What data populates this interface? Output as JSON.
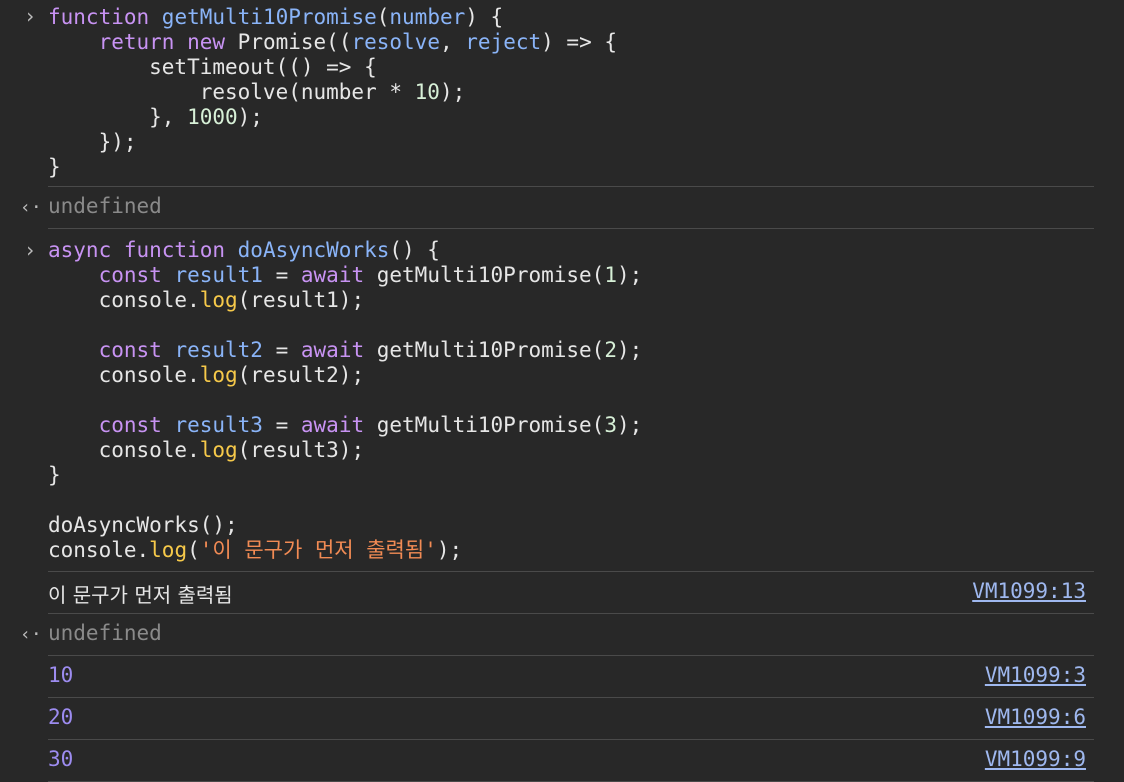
{
  "entries": [
    {
      "kind": "input",
      "lines": [
        [
          {
            "t": "kw",
            "s": "function "
          },
          {
            "t": "fn",
            "s": "getMulti10Promise"
          },
          {
            "t": "def",
            "s": "("
          },
          {
            "t": "fn",
            "s": "number"
          },
          {
            "t": "def",
            "s": ") {"
          }
        ],
        [
          {
            "t": "def",
            "s": "    "
          },
          {
            "t": "kw",
            "s": "return "
          },
          {
            "t": "kw",
            "s": "new "
          },
          {
            "t": "def",
            "s": "Promise(("
          },
          {
            "t": "fn",
            "s": "resolve"
          },
          {
            "t": "def",
            "s": ", "
          },
          {
            "t": "fn",
            "s": "reject"
          },
          {
            "t": "def",
            "s": ") => {"
          }
        ],
        [
          {
            "t": "def",
            "s": "        setTimeout(() => {"
          }
        ],
        [
          {
            "t": "def",
            "s": "            resolve(number * "
          },
          {
            "t": "num",
            "s": "10"
          },
          {
            "t": "def",
            "s": ");"
          }
        ],
        [
          {
            "t": "def",
            "s": "        }, "
          },
          {
            "t": "num",
            "s": "1000"
          },
          {
            "t": "def",
            "s": ");"
          }
        ],
        [
          {
            "t": "def",
            "s": "    });"
          }
        ],
        [
          {
            "t": "def",
            "s": "}"
          }
        ]
      ]
    },
    {
      "kind": "input",
      "lines": [
        [
          {
            "t": "kw",
            "s": "async "
          },
          {
            "t": "kw",
            "s": "function "
          },
          {
            "t": "fn",
            "s": "doAsyncWorks"
          },
          {
            "t": "def",
            "s": "() {"
          }
        ],
        [
          {
            "t": "def",
            "s": "    "
          },
          {
            "t": "kw",
            "s": "const "
          },
          {
            "t": "fn",
            "s": "result1"
          },
          {
            "t": "def",
            "s": " = "
          },
          {
            "t": "kw",
            "s": "await "
          },
          {
            "t": "def",
            "s": "getMulti10Promise("
          },
          {
            "t": "num",
            "s": "1"
          },
          {
            "t": "def",
            "s": ");"
          }
        ],
        [
          {
            "t": "def",
            "s": "    console."
          },
          {
            "t": "prop",
            "s": "log"
          },
          {
            "t": "def",
            "s": "(result1);"
          }
        ],
        [
          {
            "t": "def",
            "s": ""
          }
        ],
        [
          {
            "t": "def",
            "s": "    "
          },
          {
            "t": "kw",
            "s": "const "
          },
          {
            "t": "fn",
            "s": "result2"
          },
          {
            "t": "def",
            "s": " = "
          },
          {
            "t": "kw",
            "s": "await "
          },
          {
            "t": "def",
            "s": "getMulti10Promise("
          },
          {
            "t": "num",
            "s": "2"
          },
          {
            "t": "def",
            "s": ");"
          }
        ],
        [
          {
            "t": "def",
            "s": "    console."
          },
          {
            "t": "prop",
            "s": "log"
          },
          {
            "t": "def",
            "s": "(result2);"
          }
        ],
        [
          {
            "t": "def",
            "s": ""
          }
        ],
        [
          {
            "t": "def",
            "s": "    "
          },
          {
            "t": "kw",
            "s": "const "
          },
          {
            "t": "fn",
            "s": "result3"
          },
          {
            "t": "def",
            "s": " = "
          },
          {
            "t": "kw",
            "s": "await "
          },
          {
            "t": "def",
            "s": "getMulti10Promise("
          },
          {
            "t": "num",
            "s": "3"
          },
          {
            "t": "def",
            "s": ");"
          }
        ],
        [
          {
            "t": "def",
            "s": "    console."
          },
          {
            "t": "prop",
            "s": "log"
          },
          {
            "t": "def",
            "s": "(result3);"
          }
        ],
        [
          {
            "t": "def",
            "s": "}"
          }
        ],
        [
          {
            "t": "def",
            "s": ""
          }
        ],
        [
          {
            "t": "def",
            "s": "doAsyncWorks();"
          }
        ],
        [
          {
            "t": "def",
            "s": "console."
          },
          {
            "t": "prop",
            "s": "log"
          },
          {
            "t": "def",
            "s": "("
          },
          {
            "t": "str",
            "s": "'이 문구가 먼저 출력됨'"
          },
          {
            "t": "def",
            "s": ");"
          }
        ]
      ]
    }
  ],
  "undefined_text": "undefined",
  "log_message": {
    "text": "이 문구가 먼저 출력됨",
    "source": "VM1099:13"
  },
  "log_numbers": [
    {
      "value": "10",
      "source": "VM1099:3"
    },
    {
      "value": "20",
      "source": "VM1099:6"
    },
    {
      "value": "30",
      "source": "VM1099:9"
    }
  ],
  "icons": {
    "input_prompt": "chevron-right-icon",
    "return_value": "return-arrow-icon"
  },
  "colors": {
    "background": "#282828",
    "keyword": "#c893f3",
    "identifier": "#8ab4f8",
    "method": "#f6c94a",
    "string": "#f28b54",
    "number_output": "#9d8cf0",
    "link": "#9fb8ef"
  }
}
